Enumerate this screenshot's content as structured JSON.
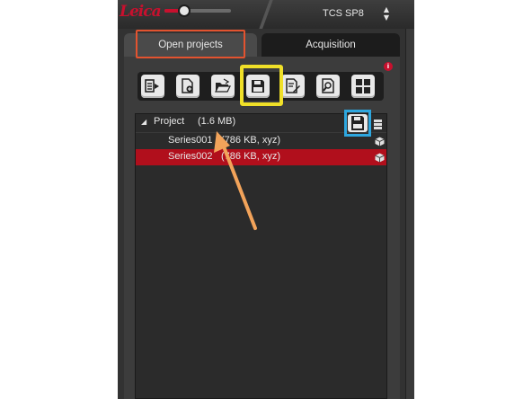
{
  "topbar": {
    "logo_text": "Leica",
    "zoom_slider_value": 0.3,
    "instrument_name": "TCS SP8"
  },
  "tabs": [
    {
      "label": "Open projects",
      "active": true
    },
    {
      "label": "Acquisition",
      "active": false
    }
  ],
  "toolbar": {
    "buttons": [
      "export-icon",
      "new-file-icon",
      "open-folder-icon",
      "save-icon",
      "edit-document-icon",
      "search-document-icon",
      "grid-icon"
    ]
  },
  "tree": {
    "project": {
      "name": "Project",
      "size": "(1.6 MB)"
    },
    "series": [
      {
        "name": "Series001",
        "info": "(786 KB, xyz)",
        "selected": false
      },
      {
        "name": "Series002",
        "info": "(786 KB, xyz)",
        "selected": true
      }
    ]
  },
  "annotations": {
    "highlight_colors": {
      "tab": "#e3532f",
      "save_button": "#f0e028",
      "project_save": "#2ea7df",
      "arrow": "#f2a35a"
    }
  },
  "colors": {
    "selection": "#b10f1c",
    "brand": "#c8102e"
  }
}
